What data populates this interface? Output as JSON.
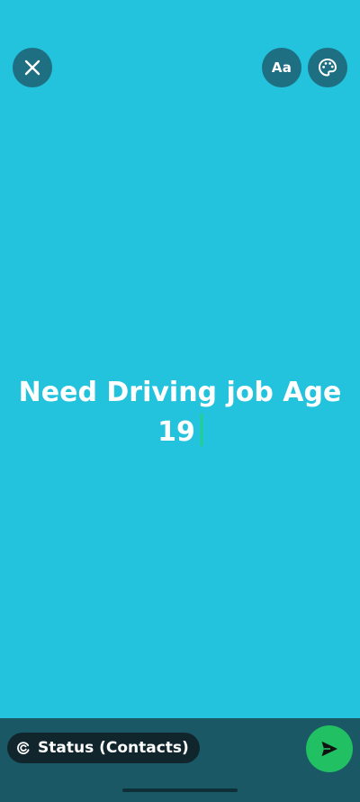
{
  "editor": {
    "background_color": "#23C2DD",
    "text": "Need Driving job Age 19",
    "caret_color": "#25D366"
  },
  "toolbar": {
    "close_icon": "close-icon",
    "font_label": "Aa",
    "palette_icon": "palette-icon"
  },
  "footer": {
    "audience_icon": "status-ring-icon",
    "audience_label": "Status (Contacts)",
    "send_icon": "send-arrow-icon",
    "send_color": "#21C063"
  }
}
